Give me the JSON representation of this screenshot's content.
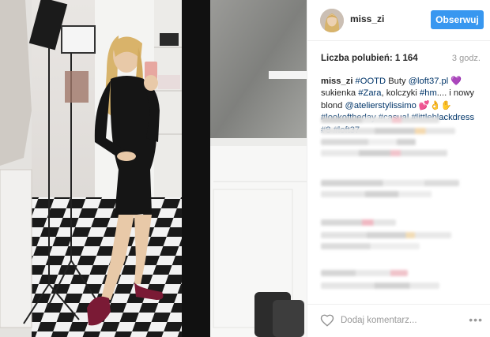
{
  "post": {
    "username": "miss_zi",
    "follow_label": "Obserwuj",
    "likes_text": "Liczba polubień: 1 164",
    "time_ago": "3 godz.",
    "caption": {
      "user": "miss_zi",
      "line1": {
        "tag": "#OOTD",
        "text_a": " Buty ",
        "mention": "@loft37.pl",
        "heart": " 💜",
        "text_b": "sukienka"
      },
      "line2": {
        "tag": "#Zara",
        "text_a": ", kolczyki ",
        "tag2": "#hm",
        "text_b": ".... i nowy blond"
      },
      "line3": {
        "mention": "@atelierstylissimo",
        "emoji": " 💕👌✋ ",
        "tag": "#lookoftheday"
      },
      "line4": {
        "tag1": "#casual",
        "tag2": "#littleblackdress",
        "tag3": "#8",
        "tag4": "#loft37"
      }
    },
    "comment_placeholder": "Dodaj komentarz...",
    "more_label": "•••"
  },
  "colors": {
    "follow_button": "#3897f0",
    "link": "#003569",
    "muted": "#999999"
  },
  "icons": {
    "like": "heart-icon",
    "more": "more-options-icon"
  }
}
